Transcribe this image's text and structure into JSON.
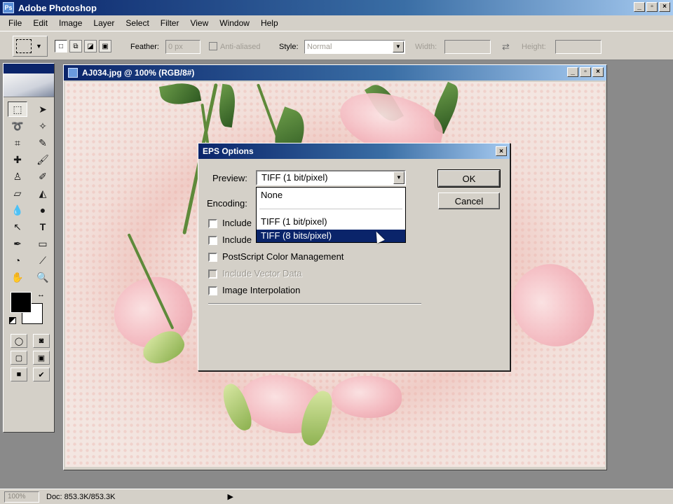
{
  "app": {
    "title": "Adobe Photoshop"
  },
  "menu": [
    "File",
    "Edit",
    "Image",
    "Layer",
    "Select",
    "Filter",
    "View",
    "Window",
    "Help"
  ],
  "options": {
    "feather_label": "Feather:",
    "feather_value": "0 px",
    "anti_aliased_label": "Anti-aliased",
    "style_label": "Style:",
    "style_value": "Normal",
    "width_label": "Width:",
    "height_label": "Height:"
  },
  "document": {
    "title": "AJ034.jpg @ 100% (RGB/8#)"
  },
  "dialog": {
    "title": "EPS Options",
    "preview_label": "Preview:",
    "preview_value": "TIFF  (1 bit/pixel)",
    "encoding_label": "Encoding:",
    "dropdown_options": [
      "None",
      "TIFF  (1 bit/pixel)",
      "TIFF  (8 bits/pixel)"
    ],
    "selected_option_index": 2,
    "checkboxes": [
      {
        "label": "Include",
        "enabled": true
      },
      {
        "label": "Include",
        "enabled": true
      },
      {
        "label": "PostScript Color Management",
        "enabled": true
      },
      {
        "label": "Include Vector Data",
        "enabled": false
      },
      {
        "label": "Image Interpolation",
        "enabled": true
      }
    ],
    "ok_label": "OK",
    "cancel_label": "Cancel"
  },
  "status": {
    "zoom": "100%",
    "doc_info": "Doc: 853.3K/853.3K"
  },
  "colors": {
    "titlebar": "#0a246a",
    "face": "#d4d0c8",
    "selection": "#0a246a",
    "canvas_pink": "#f2c3bc"
  },
  "icons": [
    "rect-marquee-icon",
    "move-icon",
    "lasso-icon",
    "magic-wand-icon",
    "crop-icon",
    "slice-icon",
    "healing-icon",
    "brush-icon",
    "stamp-icon",
    "history-brush-icon",
    "eraser-icon",
    "bucket-icon",
    "blur-icon",
    "dodge-icon",
    "path-select-icon",
    "type-icon",
    "pen-icon",
    "shape-icon",
    "notes-icon",
    "eyedropper-icon",
    "hand-icon",
    "zoom-icon"
  ]
}
